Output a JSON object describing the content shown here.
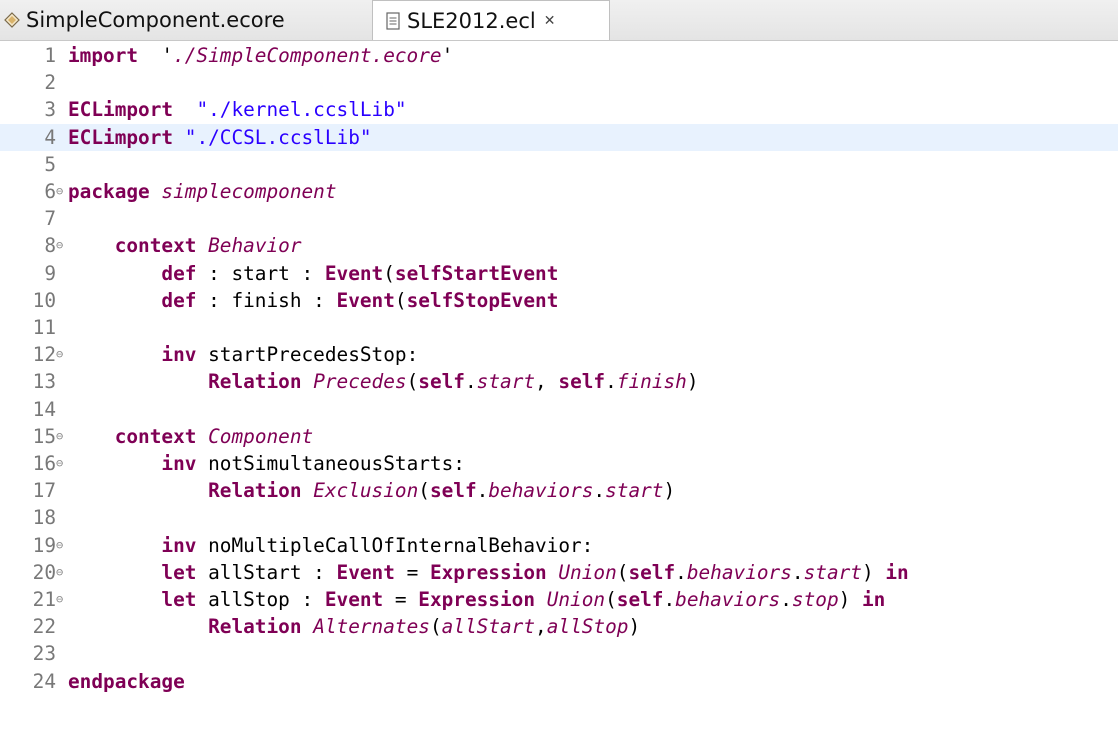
{
  "tabs": [
    {
      "label": "SimpleComponent.ecore",
      "icon": "ecore-model-icon",
      "active": false
    },
    {
      "label": "SLE2012.ecl",
      "icon": "text-file-icon",
      "active": true,
      "close": "✕"
    }
  ],
  "editor": {
    "current_line": 4,
    "lines": [
      {
        "n": "1",
        "fold": "",
        "segs": [
          [
            "kw",
            "import"
          ],
          [
            "",
            "  '"
          ],
          [
            "it",
            "./SimpleComponent.ecore"
          ],
          [
            "",
            "'"
          ]
        ]
      },
      {
        "n": "2",
        "fold": "",
        "segs": []
      },
      {
        "n": "3",
        "fold": "",
        "segs": [
          [
            "kw",
            "ECLimport"
          ],
          [
            "",
            "  "
          ],
          [
            "str",
            "\"./kernel.ccslLib\""
          ]
        ]
      },
      {
        "n": "4",
        "fold": "",
        "segs": [
          [
            "kw",
            "ECLimport"
          ],
          [
            "",
            " "
          ],
          [
            "str",
            "\"./CCSL.ccslLib\""
          ]
        ]
      },
      {
        "n": "5",
        "fold": "",
        "segs": []
      },
      {
        "n": "6",
        "fold": "⊖",
        "segs": [
          [
            "kw",
            "package"
          ],
          [
            "",
            " "
          ],
          [
            "it",
            "simplecomponent"
          ]
        ]
      },
      {
        "n": "7",
        "fold": "",
        "segs": []
      },
      {
        "n": "8",
        "fold": "⊖",
        "segs": [
          [
            "",
            "    "
          ],
          [
            "kw",
            "context"
          ],
          [
            "",
            " "
          ],
          [
            "it",
            "Behavior"
          ]
        ]
      },
      {
        "n": "9",
        "fold": "",
        "segs": [
          [
            "",
            "        "
          ],
          [
            "kw",
            "def"
          ],
          [
            "",
            " : start : "
          ],
          [
            "kw",
            "Event"
          ],
          [
            "",
            "("
          ],
          [
            "kw",
            "self"
          ],
          [
            ") = "
          ],
          [
            "kw",
            "StartEvent"
          ]
        ]
      },
      {
        "n": "10",
        "fold": "",
        "segs": [
          [
            "",
            "        "
          ],
          [
            "kw",
            "def"
          ],
          [
            "",
            " : finish : "
          ],
          [
            "kw",
            "Event"
          ],
          [
            "",
            "("
          ],
          [
            "kw",
            "self"
          ],
          [
            ") = "
          ],
          [
            "kw",
            "StopEvent"
          ]
        ]
      },
      {
        "n": "11",
        "fold": "",
        "segs": []
      },
      {
        "n": "12",
        "fold": "⊖",
        "segs": [
          [
            "",
            "        "
          ],
          [
            "kw",
            "inv"
          ],
          [
            "",
            " startPrecedesStop:"
          ]
        ]
      },
      {
        "n": "13",
        "fold": "",
        "segs": [
          [
            "",
            "            "
          ],
          [
            "kw",
            "Relation"
          ],
          [
            "",
            " "
          ],
          [
            "it",
            "Precedes"
          ],
          [
            "",
            "("
          ],
          [
            "kw",
            "self"
          ],
          [
            "",
            "."
          ],
          [
            "it",
            "start"
          ],
          [
            "",
            ", "
          ],
          [
            "kw",
            "self"
          ],
          [
            "",
            "."
          ],
          [
            "it",
            "finish"
          ],
          [
            "",
            ")"
          ]
        ]
      },
      {
        "n": "14",
        "fold": "",
        "segs": []
      },
      {
        "n": "15",
        "fold": "⊖",
        "segs": [
          [
            "",
            "    "
          ],
          [
            "kw",
            "context"
          ],
          [
            "",
            " "
          ],
          [
            "it",
            "Component"
          ]
        ]
      },
      {
        "n": "16",
        "fold": "⊖",
        "segs": [
          [
            "",
            "        "
          ],
          [
            "kw",
            "inv"
          ],
          [
            "",
            " notSimultaneousStarts:"
          ]
        ]
      },
      {
        "n": "17",
        "fold": "",
        "segs": [
          [
            "",
            "            "
          ],
          [
            "kw",
            "Relation"
          ],
          [
            "",
            " "
          ],
          [
            "it",
            "Exclusion"
          ],
          [
            "",
            "("
          ],
          [
            "kw",
            "self"
          ],
          [
            "",
            "."
          ],
          [
            "it",
            "behaviors"
          ],
          [
            "",
            "."
          ],
          [
            "it",
            "start"
          ],
          [
            "",
            ")"
          ]
        ]
      },
      {
        "n": "18",
        "fold": "",
        "segs": []
      },
      {
        "n": "19",
        "fold": "⊖",
        "segs": [
          [
            "",
            "        "
          ],
          [
            "kw",
            "inv"
          ],
          [
            "",
            " noMultipleCallOfInternalBehavior:"
          ]
        ]
      },
      {
        "n": "20",
        "fold": "⊖",
        "segs": [
          [
            "",
            "        "
          ],
          [
            "kw",
            "let"
          ],
          [
            "",
            " allStart : "
          ],
          [
            "kw",
            "Event"
          ],
          [
            "",
            " = "
          ],
          [
            "kw",
            "Expression"
          ],
          [
            "",
            " "
          ],
          [
            "it",
            "Union"
          ],
          [
            "",
            "("
          ],
          [
            "kw",
            "self"
          ],
          [
            "",
            "."
          ],
          [
            "it",
            "behaviors"
          ],
          [
            "",
            "."
          ],
          [
            "it",
            "start"
          ],
          [
            "",
            ") "
          ],
          [
            "kw",
            "in"
          ]
        ]
      },
      {
        "n": "21",
        "fold": "⊖",
        "segs": [
          [
            "",
            "        "
          ],
          [
            "kw",
            "let"
          ],
          [
            "",
            " allStop : "
          ],
          [
            "kw",
            "Event"
          ],
          [
            "",
            " = "
          ],
          [
            "kw",
            "Expression"
          ],
          [
            "",
            " "
          ],
          [
            "it",
            "Union"
          ],
          [
            "",
            "("
          ],
          [
            "kw",
            "self"
          ],
          [
            "",
            "."
          ],
          [
            "it",
            "behaviors"
          ],
          [
            "",
            "."
          ],
          [
            "it",
            "stop"
          ],
          [
            "",
            ") "
          ],
          [
            "kw",
            "in"
          ]
        ]
      },
      {
        "n": "22",
        "fold": "",
        "segs": [
          [
            "",
            "            "
          ],
          [
            "kw",
            "Relation"
          ],
          [
            "",
            " "
          ],
          [
            "it",
            "Alternates"
          ],
          [
            "",
            "("
          ],
          [
            "it",
            "allStart"
          ],
          [
            "",
            ","
          ],
          [
            "it",
            "allStop"
          ],
          [
            "",
            ")"
          ]
        ]
      },
      {
        "n": "23",
        "fold": "",
        "segs": []
      },
      {
        "n": "24",
        "fold": "",
        "segs": [
          [
            "kw",
            "endpackage"
          ]
        ]
      }
    ]
  }
}
